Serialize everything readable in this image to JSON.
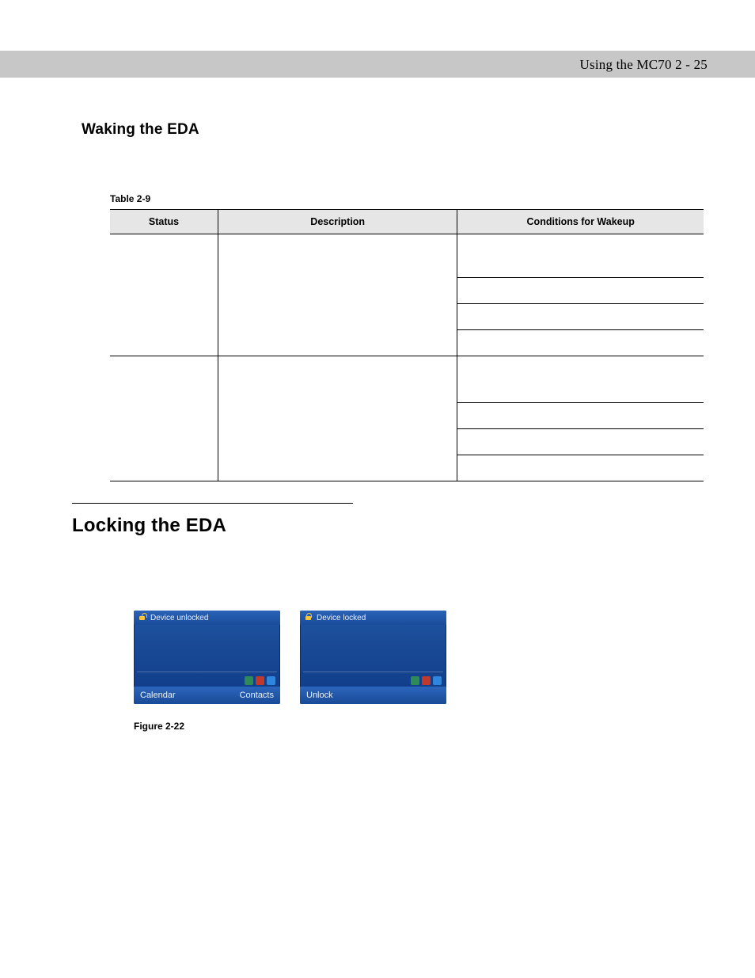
{
  "header": {
    "breadcrumb": "Using the MC70    2 - 25"
  },
  "section1": {
    "title": "Waking the EDA"
  },
  "table": {
    "caption": "Table 2-9",
    "columns": [
      "Status",
      "Description",
      "Conditions for Wakeup"
    ]
  },
  "section2": {
    "title": "Locking the EDA"
  },
  "figure": {
    "caption": "Figure 2-22",
    "shot1": {
      "icon": "lock-open-icon",
      "title": "Device unlocked",
      "softkey_left": "Calendar",
      "softkey_right": "Contacts"
    },
    "shot2": {
      "icon": "lock-closed-icon",
      "title": "Device locked",
      "softkey_left": "Unlock",
      "softkey_right": ""
    }
  }
}
